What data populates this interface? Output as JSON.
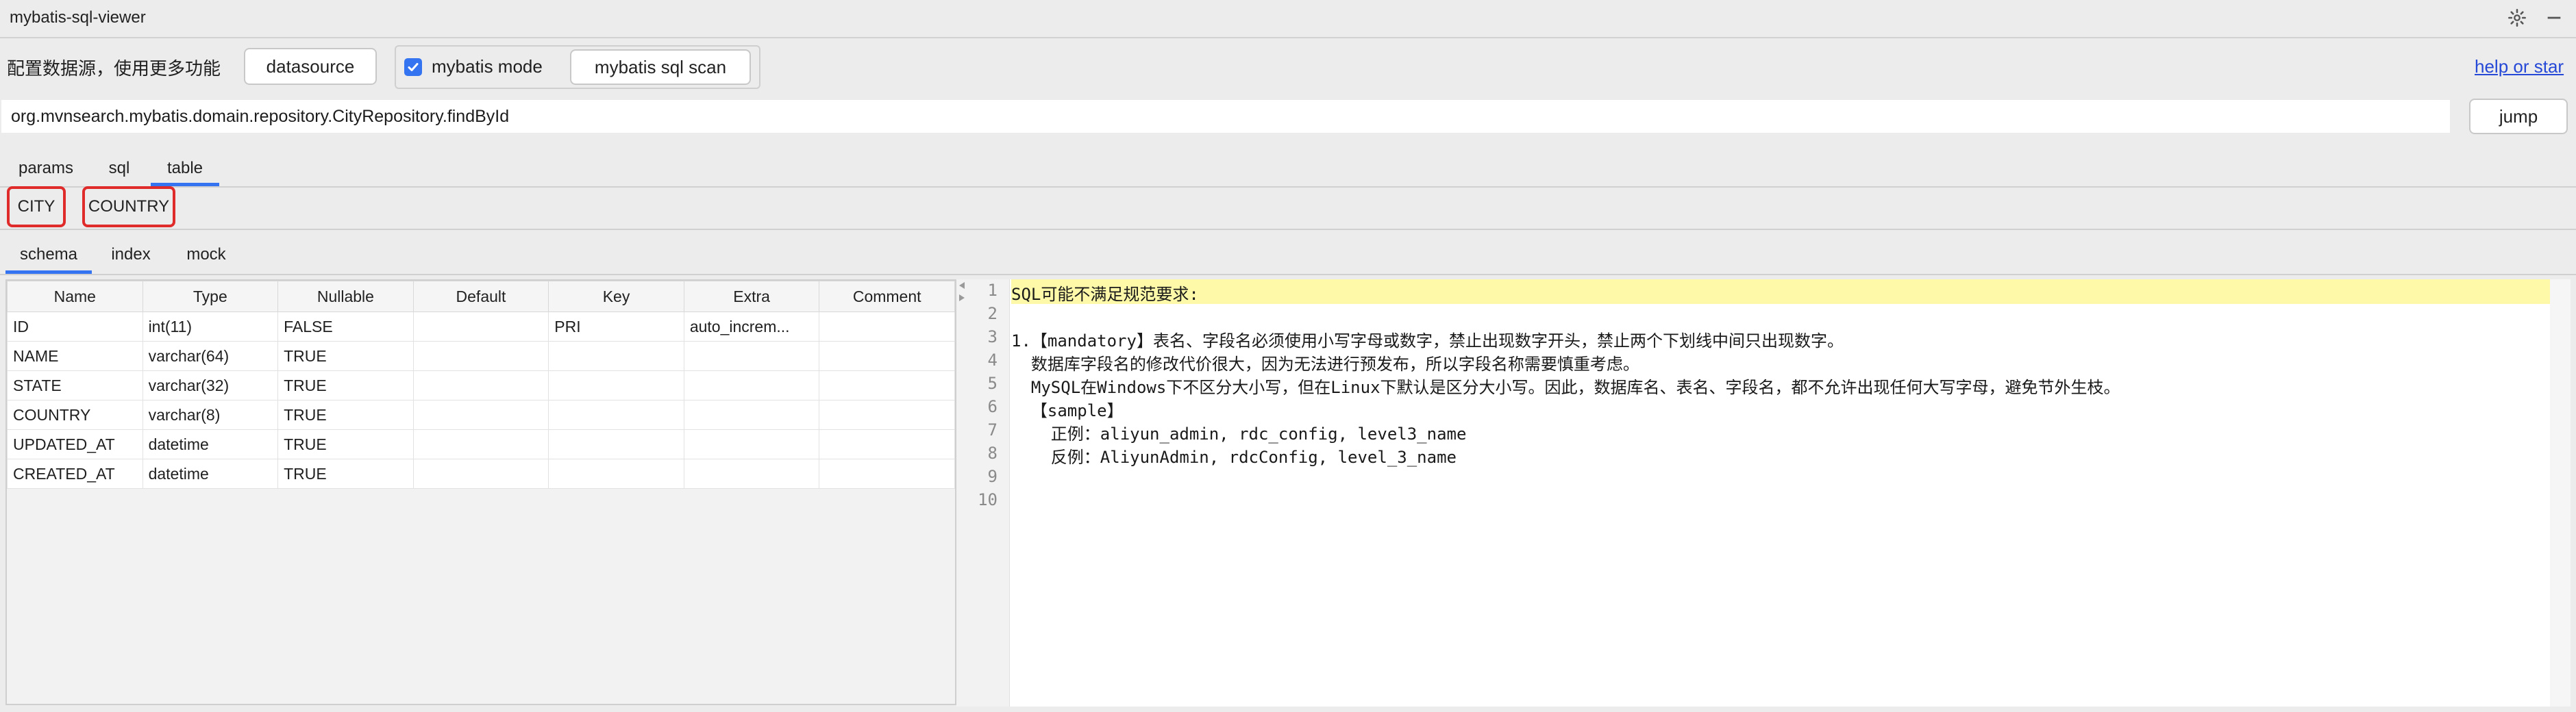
{
  "window": {
    "title": "mybatis-sql-viewer"
  },
  "toolbar": {
    "config_text": "配置数据源，使用更多功能",
    "datasource_label": "datasource",
    "mybatis_mode_label": "mybatis mode",
    "mybatis_mode_checked": true,
    "scan_label": "mybatis sql scan",
    "help_link": "help or star"
  },
  "path_bar": {
    "value": "org.mvnsearch.mybatis.domain.repository.CityRepository.findById",
    "jump_label": "jump"
  },
  "main_tabs": [
    "params",
    "sql",
    "table"
  ],
  "main_tab_selected": "table",
  "table_tabs": [
    "CITY",
    "COUNTRY"
  ],
  "sub_tabs": [
    "schema",
    "index",
    "mock"
  ],
  "sub_tab_selected": "schema",
  "schema_table": {
    "columns": [
      "Name",
      "Type",
      "Nullable",
      "Default",
      "Key",
      "Extra",
      "Comment"
    ],
    "rows": [
      [
        "ID",
        "int(11)",
        "FALSE",
        "",
        "PRI",
        "auto_increm...",
        ""
      ],
      [
        "NAME",
        "varchar(64)",
        "TRUE",
        "",
        "",
        "",
        ""
      ],
      [
        "STATE",
        "varchar(32)",
        "TRUE",
        "",
        "",
        "",
        ""
      ],
      [
        "COUNTRY",
        "varchar(8)",
        "TRUE",
        "",
        "",
        "",
        ""
      ],
      [
        "UPDATED_AT",
        "datetime",
        "TRUE",
        "",
        "",
        "",
        ""
      ],
      [
        "CREATED_AT",
        "datetime",
        "TRUE",
        "",
        "",
        "",
        ""
      ]
    ]
  },
  "editor": {
    "lines": [
      {
        "num": "1",
        "text": "SQL可能不满足规范要求:"
      },
      {
        "num": "2",
        "text": ""
      },
      {
        "num": "3",
        "text": "1.【mandatory】表名、字段名必须使用小写字母或数字，禁止出现数字开头，禁止两个下划线中间只出现数字。"
      },
      {
        "num": "4",
        "text": "  数据库字段名的修改代价很大，因为无法进行预发布，所以字段名称需要慎重考虑。"
      },
      {
        "num": "5",
        "text": "  MySQL在Windows下不区分大小写，但在Linux下默认是区分大小写。因此，数据库名、表名、字段名，都不允许出现任何大写字母，避免节外生枝。"
      },
      {
        "num": "6",
        "text": "  【sample】"
      },
      {
        "num": "7",
        "text": "    正例：aliyun_admin, rdc_config, level3_name"
      },
      {
        "num": "8",
        "text": "    反例：AliyunAdmin, rdcConfig, level_3_name"
      },
      {
        "num": "9",
        "text": ""
      },
      {
        "num": "10",
        "text": ""
      }
    ]
  },
  "colors": {
    "accent": "#3574f0",
    "highlight": "#fdf9a8",
    "annotation": "#e02b2b"
  }
}
